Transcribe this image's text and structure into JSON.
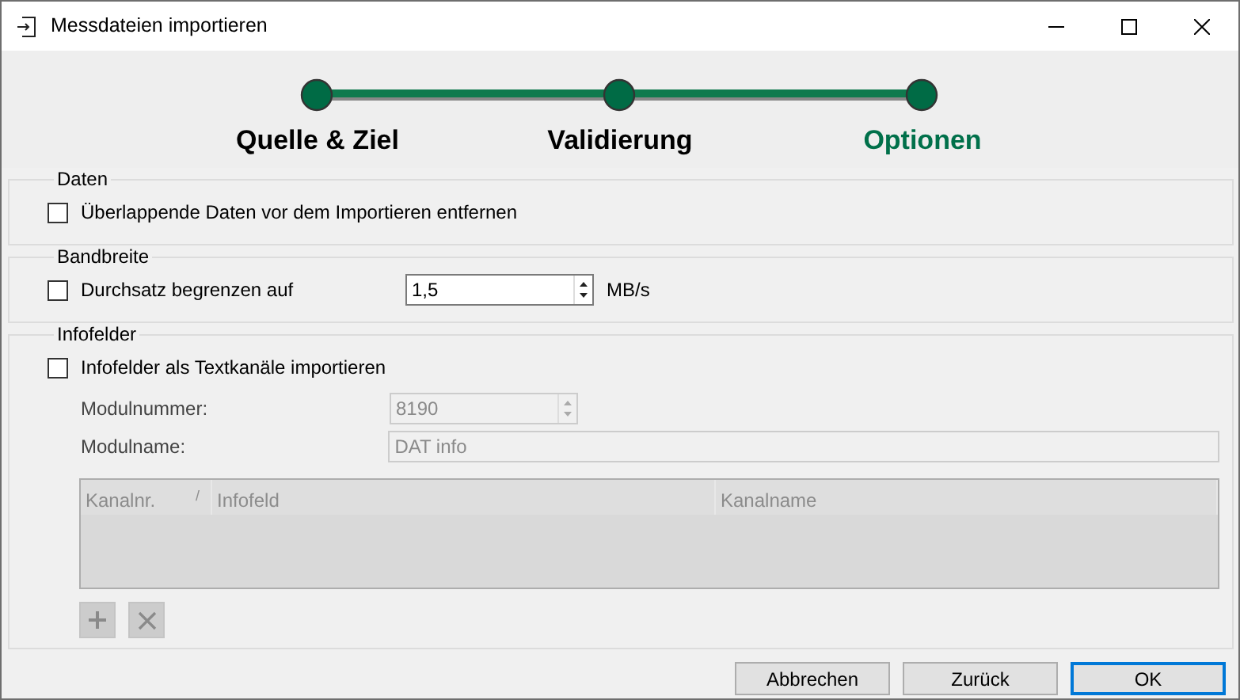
{
  "window": {
    "title": "Messdateien importieren"
  },
  "steps": [
    {
      "label": "Quelle & Ziel",
      "selected": false
    },
    {
      "label": "Validierung",
      "selected": false
    },
    {
      "label": "Optionen",
      "selected": true
    }
  ],
  "groups": [
    {
      "title": "Daten",
      "options": [
        {
          "kind": "checkbox",
          "label": "Überlappende Daten vor dem Importieren entfernen",
          "checked": false
        }
      ]
    },
    {
      "title": "Bandbreite",
      "options": [
        {
          "kind": "spin",
          "label": "Durchsatz begrenzen auf",
          "checked": false,
          "value": "1,5",
          "disabled": false,
          "unit": "MB/s"
        }
      ]
    },
    {
      "title": "Infofelder",
      "options": [
        {
          "kind": "checkbox",
          "label": "Infofelder als Textkanäle importieren",
          "checked": false
        },
        {
          "kind": "spin-field",
          "label": "Modulnummer:",
          "value": "8190",
          "disabled": true
        },
        {
          "kind": "text-field",
          "label": "Modulname:",
          "value": "DAT info",
          "disabled": true
        }
      ],
      "table": {
        "columns": [
          "Kanalnr.",
          "Infofeld",
          "Kanalname"
        ],
        "sort_mark": "/",
        "disabled": true
      },
      "tools": [
        {
          "kind": "add",
          "disabled": true
        },
        {
          "kind": "delete",
          "disabled": true
        }
      ]
    }
  ],
  "buttons": [
    {
      "label": "Abbrechen",
      "default": false
    },
    {
      "label": "Zurück",
      "default": false
    },
    {
      "label": "OK",
      "default": true
    }
  ]
}
